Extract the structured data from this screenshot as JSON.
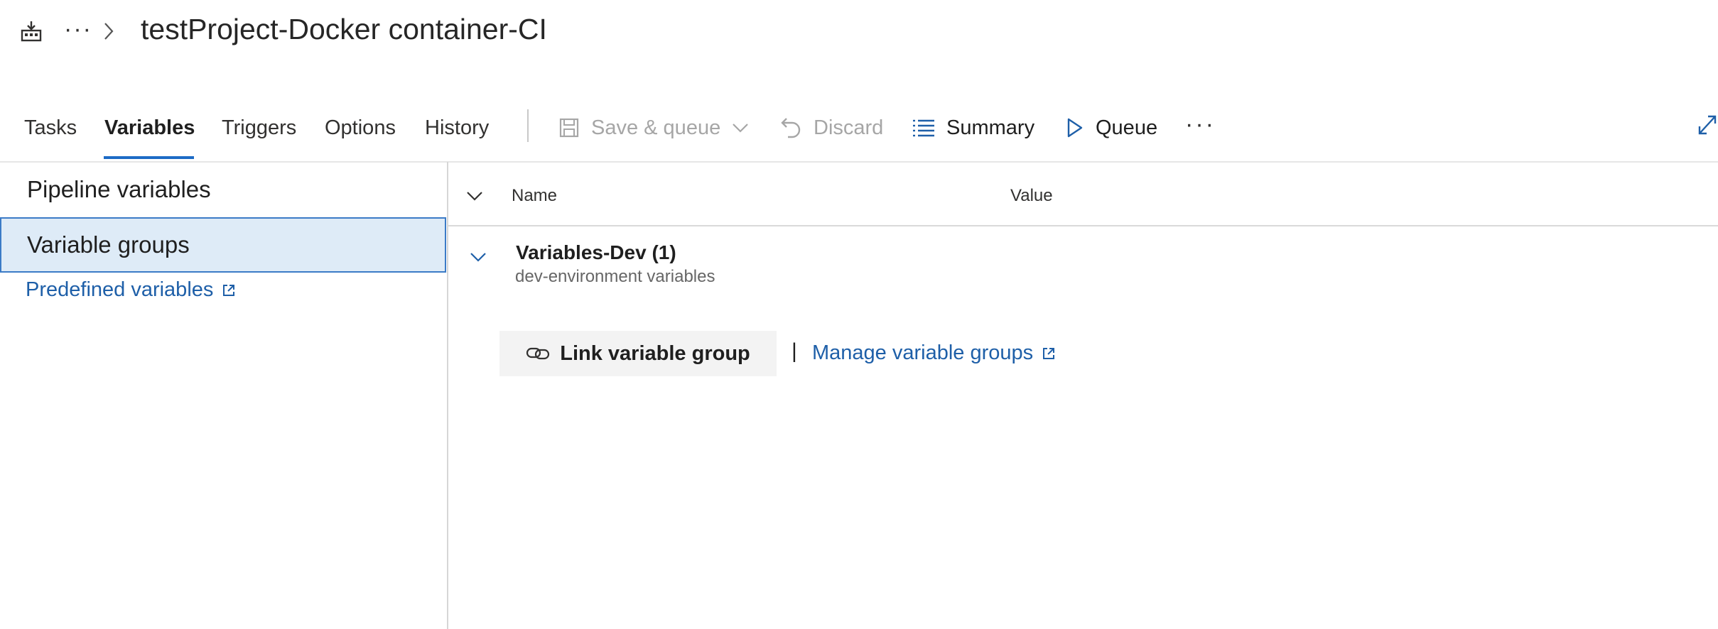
{
  "header": {
    "title": "testProject-Docker container-CI",
    "overflow_label": "···",
    "icon": "pipeline-build-icon"
  },
  "tabs": [
    {
      "label": "Tasks",
      "active": false
    },
    {
      "label": "Variables",
      "active": true
    },
    {
      "label": "Triggers",
      "active": false
    },
    {
      "label": "Options",
      "active": false
    },
    {
      "label": "History",
      "active": false
    }
  ],
  "toolbar": {
    "save_queue_label": "Save & queue",
    "discard_label": "Discard",
    "summary_label": "Summary",
    "queue_label": "Queue",
    "more_label": "···"
  },
  "sidebar": {
    "items": [
      {
        "label": "Pipeline variables",
        "selected": false
      },
      {
        "label": "Variable groups",
        "selected": true
      }
    ],
    "predefined_link": "Predefined variables"
  },
  "grid": {
    "columns": [
      "Name",
      "Value"
    ],
    "group": {
      "name": "Variables-Dev (1)",
      "description": "dev-environment variables"
    }
  },
  "actions": {
    "link_button": "Link variable group",
    "separator": "|",
    "manage_link": "Manage variable groups"
  },
  "colors": {
    "accent": "#1d6bc6",
    "link": "#1e5fa8",
    "selected_bg": "#deebf7",
    "disabled_text": "#a6a6a6"
  }
}
